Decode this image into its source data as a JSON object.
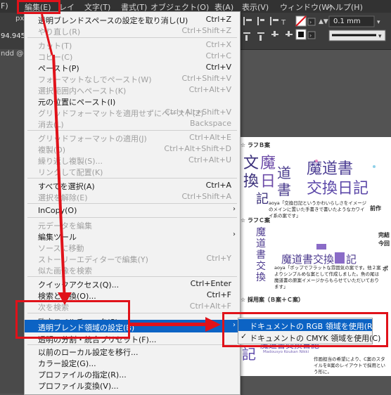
{
  "menubar": {
    "items": [
      "F)",
      "編集(E)",
      "レイ",
      "文字(T)",
      "書式(T)",
      "オブジェクト(O)",
      "表(A)",
      "表示(V)",
      "ウィンドウ(W)",
      "ヘルプ(H)"
    ]
  },
  "toolbar": {
    "stroke_value": "0.1 mm",
    "left_value": "94.945"
  },
  "left_strip": {
    "tab_text": "ndd @ 4",
    "unit": "px"
  },
  "edit_menu": {
    "items": [
      {
        "label": "透明ブレンドスペースの設定を取り消し(U)",
        "shortcut": "Ctrl+Z",
        "enabled": true
      },
      {
        "label": "やり直し(R)",
        "shortcut": "Ctrl+Shift+Z",
        "enabled": false
      },
      {
        "label": "カット(T)",
        "shortcut": "Ctrl+X",
        "enabled": false
      },
      {
        "label": "コピー(C)",
        "shortcut": "Ctrl+C",
        "enabled": false
      },
      {
        "label": "ペースト(P)",
        "shortcut": "Ctrl+V",
        "enabled": true
      },
      {
        "label": "フォーマットなしでペースト(W)",
        "shortcut": "Ctrl+Shift+V",
        "enabled": false
      },
      {
        "label": "選択範囲内へペースト(K)",
        "shortcut": "Ctrl+Alt+V",
        "enabled": false
      },
      {
        "label": "元の位置にペースト(I)",
        "shortcut": "",
        "enabled": true
      },
      {
        "label": "グリッドフォーマットを適用せずにペースト(Z)",
        "shortcut": "Ctrl+Alt+Shift+V",
        "enabled": false
      },
      {
        "label": "消去(L)",
        "shortcut": "Backspace",
        "enabled": false
      },
      {
        "label": "グリッドフォーマットの適用(J)",
        "shortcut": "Ctrl+Alt+E",
        "enabled": false
      },
      {
        "label": "複製(D)",
        "shortcut": "Ctrl+Alt+Shift+D",
        "enabled": false
      },
      {
        "label": "繰り返し複製(S)...",
        "shortcut": "Ctrl+Alt+U",
        "enabled": false
      },
      {
        "label": "リンクして配置(K)",
        "shortcut": "",
        "enabled": false
      },
      {
        "label": "すべてを選択(A)",
        "shortcut": "Ctrl+A",
        "enabled": true
      },
      {
        "label": "選択を解除(E)",
        "shortcut": "Ctrl+Shift+A",
        "enabled": false
      },
      {
        "label": "InCopy(O)",
        "shortcut": "",
        "enabled": true,
        "submenu": true
      },
      {
        "label": "元データを編集",
        "shortcut": "",
        "enabled": false
      },
      {
        "label": "編集ツール",
        "shortcut": "",
        "enabled": true,
        "submenu": true
      },
      {
        "label": "ソースに移動",
        "shortcut": "",
        "enabled": false
      },
      {
        "label": "ストーリーエディターで編集(Y)",
        "shortcut": "Ctrl+Y",
        "enabled": false
      },
      {
        "label": "似た画像を検索",
        "shortcut": "",
        "enabled": false
      },
      {
        "label": "クイックアクセス(Q)...",
        "shortcut": "Ctrl+Enter",
        "enabled": true
      },
      {
        "label": "検索と置換(O)...",
        "shortcut": "Ctrl+F",
        "enabled": true
      },
      {
        "label": "次を検索",
        "shortcut": "Ctrl+Alt+F",
        "enabled": false
      },
      {
        "label": "欧文スペルチェック(S)",
        "shortcut": "",
        "enabled": true,
        "submenu": true
      },
      {
        "label": "透明ブレンド領域の設定(B)",
        "shortcut": "",
        "enabled": true,
        "submenu": true,
        "highlighted": true
      },
      {
        "label": "透明の分割・統合プリセット(F)...",
        "shortcut": "",
        "enabled": true
      },
      {
        "label": "以前のローカル設定を移行...",
        "shortcut": "",
        "enabled": true
      },
      {
        "label": "カラー設定(G)...",
        "shortcut": "",
        "enabled": true
      },
      {
        "label": "プロファイルの指定(R)...",
        "shortcut": "",
        "enabled": true
      },
      {
        "label": "プロファイル変換(V)...",
        "shortcut": "",
        "enabled": true
      }
    ]
  },
  "blend_submenu": {
    "items": [
      {
        "label": "ドキュメントの RGB 領域を使用(R)",
        "checked": false,
        "highlighted": true
      },
      {
        "label": "ドキュメントの CMYK 領域を使用(C)",
        "checked": true,
        "highlighted": false
      }
    ]
  },
  "document": {
    "sec1_label": "☆ ラフＢ案",
    "sec2_label": "☆ ラフＣ案",
    "sec3_label": "☆ 採用案（Ｂ案＋Ｃ案）",
    "art1_text": "魔道書交換日記",
    "note1": "aoya「交換日記というかわいらしさをイメージのメインに置いた手書きで書いたようなカワイイ系の案です」",
    "side1": "前作",
    "side2": "完結",
    "side3": "今回",
    "art2_text": "魔道書交換日記",
    "note2": "aoya「ポップでフラットな雰囲気の案です。他２案よりシンプルめな案として作成しました。魚の尾は魔道書の原案イメージからもらせていただいております」",
    "side4": "ポ",
    "art3_text": "魔道書交換日記",
    "art3_sub": "Madousyo Koukan Nikki",
    "note3": "作画担当の希望により、C案のスタイルをB案のレイアウトで採用という形に。"
  }
}
